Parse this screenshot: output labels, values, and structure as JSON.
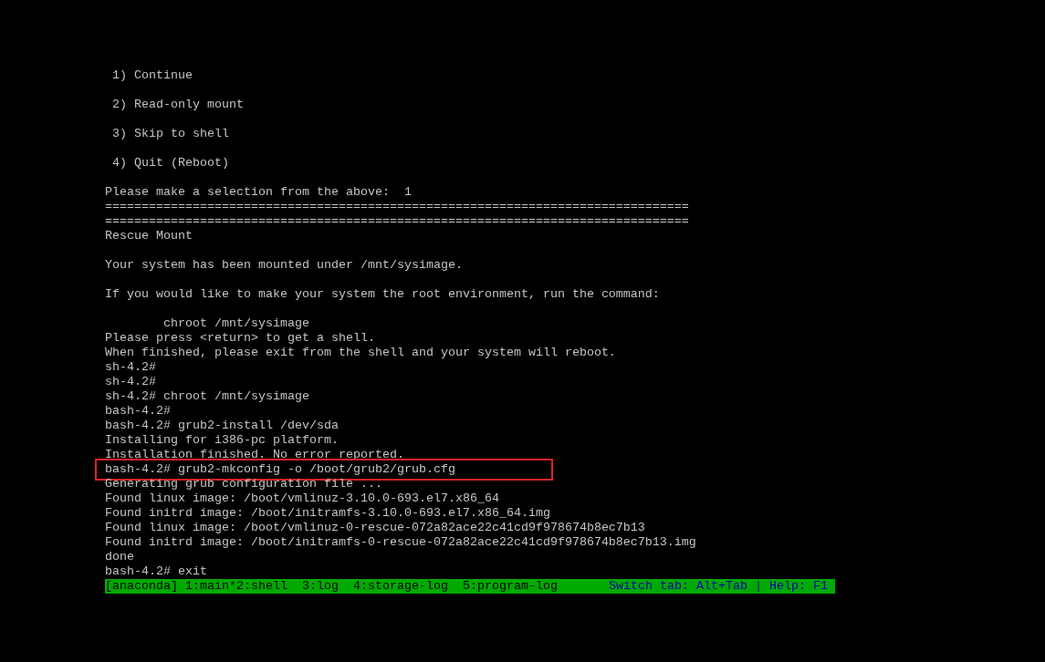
{
  "terminal": {
    "lines": [
      {
        "kind": "text",
        "text": " 1) Continue"
      },
      {
        "kind": "blank"
      },
      {
        "kind": "text",
        "text": " 2) Read-only mount"
      },
      {
        "kind": "blank"
      },
      {
        "kind": "text",
        "text": " 3) Skip to shell"
      },
      {
        "kind": "blank"
      },
      {
        "kind": "text",
        "text": " 4) Quit (Reboot)"
      },
      {
        "kind": "blank"
      },
      {
        "kind": "text",
        "text": "Please make a selection from the above:  1"
      },
      {
        "kind": "text",
        "text": "================================================================================"
      },
      {
        "kind": "text",
        "text": "================================================================================"
      },
      {
        "kind": "text",
        "text": "Rescue Mount"
      },
      {
        "kind": "blank"
      },
      {
        "kind": "text",
        "text": "Your system has been mounted under /mnt/sysimage."
      },
      {
        "kind": "blank"
      },
      {
        "kind": "text",
        "text": "If you would like to make your system the root environment, run the command:"
      },
      {
        "kind": "blank"
      },
      {
        "kind": "text",
        "text": "        chroot /mnt/sysimage"
      },
      {
        "kind": "text",
        "text": "Please press <return> to get a shell."
      },
      {
        "kind": "text",
        "text": "When finished, please exit from the shell and your system will reboot."
      },
      {
        "kind": "text",
        "text": "sh-4.2#"
      },
      {
        "kind": "text",
        "text": "sh-4.2#"
      },
      {
        "kind": "text",
        "text": "sh-4.2# chroot /mnt/sysimage"
      },
      {
        "kind": "text",
        "text": "bash-4.2#"
      },
      {
        "kind": "text",
        "text": "bash-4.2# grub2-install /dev/sda"
      },
      {
        "kind": "text",
        "text": "Installing for i386-pc platform."
      },
      {
        "kind": "text",
        "text": "Installation finished. No error reported."
      },
      {
        "kind": "boxed",
        "text": "bash-4.2# grub2-mkconfig -o /boot/grub2/grub.cfg"
      },
      {
        "kind": "text",
        "text": "Generating grub configuration file ..."
      },
      {
        "kind": "text",
        "text": "Found linux image: /boot/vmlinuz-3.10.0-693.el7.x86_64"
      },
      {
        "kind": "text",
        "text": "Found initrd image: /boot/initramfs-3.10.0-693.el7.x86_64.img"
      },
      {
        "kind": "text",
        "text": "Found linux image: /boot/vmlinuz-0-rescue-072a82ace22c41cd9f978674b8ec7b13"
      },
      {
        "kind": "text",
        "text": "Found initrd image: /boot/initramfs-0-rescue-072a82ace22c41cd9f978674b8ec7b13.img"
      },
      {
        "kind": "text",
        "text": "done"
      },
      {
        "kind": "text",
        "text": "bash-4.2# exit"
      }
    ]
  },
  "status_bar": {
    "label": "[anaconda]",
    "tabs": [
      "1:main*",
      "2:shell",
      "3:log",
      "4:storage-log",
      "5:program-log"
    ],
    "help": "Switch tab: Alt+Tab | Help: F1"
  }
}
